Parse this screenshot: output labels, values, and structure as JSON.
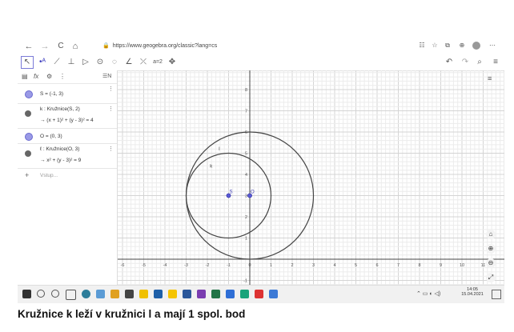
{
  "browser": {
    "back_icon": "←",
    "forward_icon": "→",
    "reload_icon": "C",
    "home_icon": "⌂",
    "url": "https://www.geogebra.org/classic?lang=cs"
  },
  "algebra": {
    "items": [
      {
        "text": "S = (-1, 3)",
        "dot_color": "#8a8ae0"
      },
      {
        "text": "k : Kružnice(S, 2)",
        "equation": "→  (x + 1)² + (y - 3)² = 4",
        "dot_color": "#555555"
      },
      {
        "text": "O = (0, 3)",
        "dot_color": "#8a8ae0"
      },
      {
        "text": "ℓ : Kružnice(O, 3)",
        "equation": "→  x² + (y - 3)² = 9",
        "dot_color": "#555555"
      }
    ],
    "input_placeholder": "Vstup..."
  },
  "graph": {
    "x_ticks": [
      "-6",
      "-5",
      "-4",
      "-3",
      "-2",
      "-1",
      "0",
      "1",
      "2",
      "3",
      "4",
      "5",
      "6",
      "7",
      "8",
      "9",
      "10",
      "11"
    ],
    "y_ticks": [
      "-1",
      "1",
      "2",
      "3",
      "4",
      "5",
      "6",
      "7",
      "8"
    ],
    "points": [
      {
        "label": "S",
        "x": -1,
        "y": 3
      },
      {
        "label": "O",
        "x": 0,
        "y": 3
      }
    ],
    "circles": [
      {
        "label": "k",
        "cx": -1,
        "cy": 3,
        "r": 2
      },
      {
        "label": "l",
        "cx": 0,
        "cy": 3,
        "r": 3
      }
    ]
  },
  "taskbar": {
    "time": "14:05",
    "date": "15.04.2021"
  },
  "caption": "Kružnice k leží v kružnici l a mají 1 spol. bod"
}
